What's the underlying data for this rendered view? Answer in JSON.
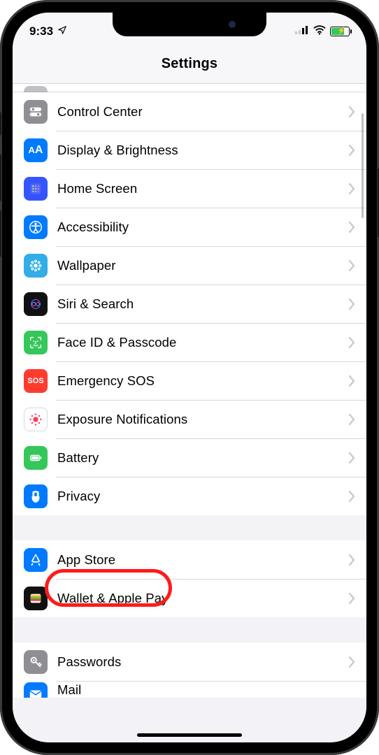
{
  "status": {
    "time": "9:33"
  },
  "header": {
    "title": "Settings"
  },
  "rows": {
    "control_center": "Control Center",
    "display": "Display & Brightness",
    "home": "Home Screen",
    "accessibility": "Accessibility",
    "wallpaper": "Wallpaper",
    "siri": "Siri & Search",
    "faceid": "Face ID & Passcode",
    "sos": "Emergency SOS",
    "exposure": "Exposure Notifications",
    "battery": "Battery",
    "privacy": "Privacy",
    "appstore": "App Store",
    "wallet": "Wallet & Apple Pay",
    "passwords": "Passwords",
    "mail": "Mail",
    "sos_label": "SOS"
  },
  "highlighted_item": "privacy"
}
